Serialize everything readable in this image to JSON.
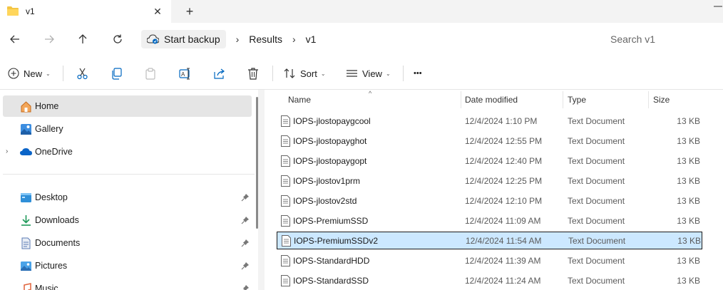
{
  "tab": {
    "title": "v1",
    "close_glyph": "✕",
    "new_tab_glyph": "+"
  },
  "breadcrumb": [
    "Start backup",
    "Results",
    "v1"
  ],
  "search": {
    "placeholder": "Search v1"
  },
  "commands": {
    "new_label": "New",
    "sort_label": "Sort",
    "view_label": "View",
    "more_glyph": "•••"
  },
  "sidebar": {
    "items": [
      {
        "label": "Home",
        "icon": "home-icon"
      },
      {
        "label": "Gallery",
        "icon": "gallery-icon"
      },
      {
        "label": "OneDrive",
        "icon": "cloud-icon"
      },
      {
        "label": "Desktop",
        "icon": "desktop-icon"
      },
      {
        "label": "Downloads",
        "icon": "download-icon"
      },
      {
        "label": "Documents",
        "icon": "documents-icon"
      },
      {
        "label": "Pictures",
        "icon": "pictures-icon"
      },
      {
        "label": "Music",
        "icon": "music-icon"
      }
    ]
  },
  "columns": {
    "name": "Name",
    "date": "Date modified",
    "type": "Type",
    "size": "Size"
  },
  "files": [
    {
      "name": "IOPS-jlostopaygcool",
      "date": "12/4/2024 1:10 PM",
      "type": "Text Document",
      "size": "13 KB"
    },
    {
      "name": "IOPS-jlostopayghot",
      "date": "12/4/2024 12:55 PM",
      "type": "Text Document",
      "size": "13 KB"
    },
    {
      "name": "IOPS-jlostopaygopt",
      "date": "12/4/2024 12:40 PM",
      "type": "Text Document",
      "size": "13 KB"
    },
    {
      "name": "IOPS-jlostov1prm",
      "date": "12/4/2024 12:25 PM",
      "type": "Text Document",
      "size": "13 KB"
    },
    {
      "name": "IOPS-jlostov2std",
      "date": "12/4/2024 12:10 PM",
      "type": "Text Document",
      "size": "13 KB"
    },
    {
      "name": "IOPS-PremiumSSD",
      "date": "12/4/2024 11:09 AM",
      "type": "Text Document",
      "size": "13 KB"
    },
    {
      "name": "IOPS-PremiumSSDv2",
      "date": "12/4/2024 11:54 AM",
      "type": "Text Document",
      "size": "13 KB"
    },
    {
      "name": "IOPS-StandardHDD",
      "date": "12/4/2024 11:39 AM",
      "type": "Text Document",
      "size": "13 KB"
    },
    {
      "name": "IOPS-StandardSSD",
      "date": "12/4/2024 11:24 AM",
      "type": "Text Document",
      "size": "13 KB"
    }
  ],
  "colors": {
    "selected_row": "#cce8ff",
    "accent": "#0067c0",
    "folder": "#f4c543"
  }
}
